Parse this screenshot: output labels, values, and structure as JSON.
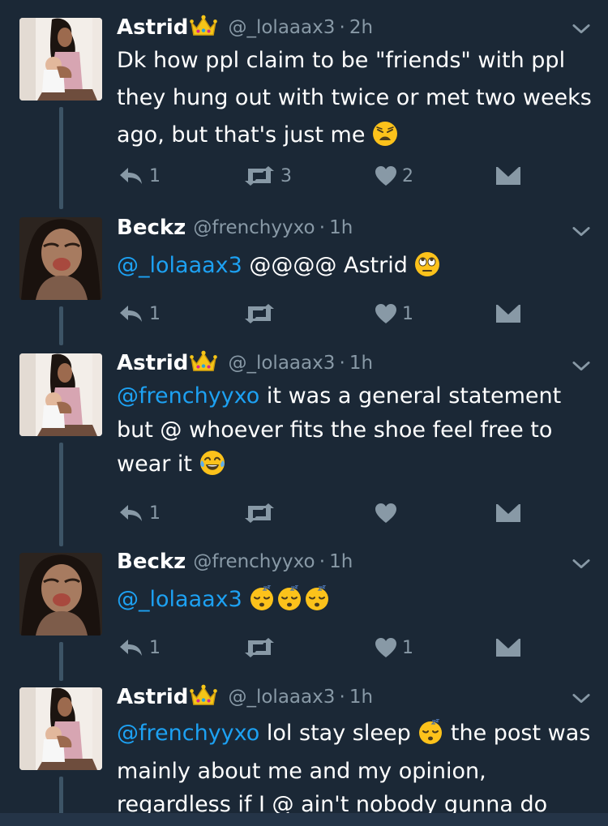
{
  "tweets": [
    {
      "name": "Astrid",
      "handle": "@_lolaaax3",
      "time": "2h",
      "text_parts": [
        {
          "t": "Dk how ppl claim to be \"friends\" with ppl they hung out with twice or met two weeks ago, but that's just me "
        }
      ],
      "emoji": [
        "weary-face-emoji"
      ],
      "reply_count": "1",
      "retweet_count": "3",
      "like_count": "2"
    },
    {
      "name": "Beckz",
      "handle": "@frenchyyxo",
      "time": "1h",
      "mention": "@_lolaaax3",
      "text": " @@@@ Astrid ",
      "emoji": [
        "eye-roll-emoji"
      ],
      "reply_count": "1",
      "retweet_count": "",
      "like_count": "1"
    },
    {
      "name": "Astrid",
      "handle": "@_lolaaax3",
      "time": "1h",
      "mention": "@frenchyyxo",
      "text": " it was a general statement but @ whoever fits the shoe feel free to wear it ",
      "emoji": [
        "tears-of-joy-emoji"
      ],
      "reply_count": "1",
      "retweet_count": "",
      "like_count": ""
    },
    {
      "name": "Beckz",
      "handle": "@frenchyyxo",
      "time": "1h",
      "mention": "@_lolaaax3",
      "text": " ",
      "emoji": [
        "sleeping-face-emoji",
        "sleeping-face-emoji",
        "sleeping-face-emoji"
      ],
      "reply_count": "1",
      "retweet_count": "",
      "like_count": "1"
    },
    {
      "name": "Astrid",
      "handle": "@_lolaaax3",
      "time": "1h",
      "mention": "@frenchyyxo",
      "text_a": " lol stay sleep ",
      "text_b": " the post was mainly about me and my opinion, regardless if I @ ain't nobody gunna do",
      "emoji": [
        "sleeping-face-emoji"
      ]
    }
  ],
  "separator": "·",
  "icons": {
    "reply": "reply-icon",
    "retweet": "retweet-icon",
    "like": "heart-icon",
    "dm": "envelope-icon",
    "menu": "chevron-down-icon",
    "crown": "crown-emoji"
  },
  "colors": {
    "background": "#1b2836",
    "mention": "#1da1f2",
    "muted": "#8899a6",
    "thread": "#3d5466"
  }
}
